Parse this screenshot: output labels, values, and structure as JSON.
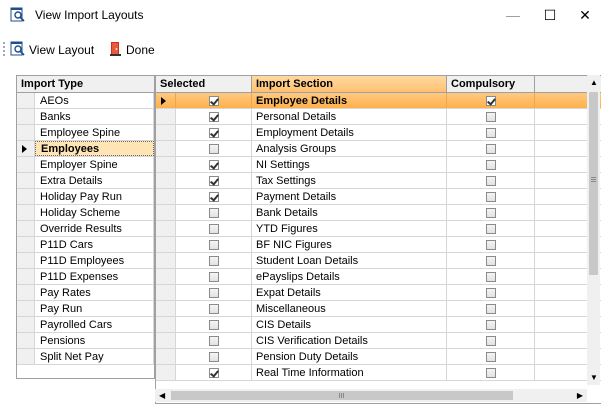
{
  "window": {
    "title": "View Import Layouts",
    "minimize_glyph": "—",
    "maximize_glyph": "☐",
    "close_glyph": "✕"
  },
  "toolbar": {
    "view_layout_label": "View Layout",
    "done_label": "Done"
  },
  "import_type": {
    "header": "Import Type",
    "items": [
      {
        "label": "AEOs"
      },
      {
        "label": "Banks"
      },
      {
        "label": "Employee Spine"
      },
      {
        "label": "Employees",
        "selected": true
      },
      {
        "label": "Employer Spine"
      },
      {
        "label": "Extra Details"
      },
      {
        "label": "Holiday Pay Run"
      },
      {
        "label": "Holiday Scheme"
      },
      {
        "label": "Override Results"
      },
      {
        "label": "P11D Cars"
      },
      {
        "label": "P11D Employees"
      },
      {
        "label": "P11D Expenses"
      },
      {
        "label": "Pay Rates"
      },
      {
        "label": "Pay Run"
      },
      {
        "label": "Payrolled Cars"
      },
      {
        "label": "Pensions"
      },
      {
        "label": "Split Net Pay"
      }
    ]
  },
  "import_section": {
    "headers": {
      "selected": "Selected",
      "section": "Import Section",
      "compulsory": "Compulsory"
    },
    "rows": [
      {
        "section": "Employee Details",
        "selected": true,
        "compulsory": true,
        "current": true
      },
      {
        "section": "Personal Details",
        "selected": true,
        "compulsory": false
      },
      {
        "section": "Employment Details",
        "selected": true,
        "compulsory": false
      },
      {
        "section": "Analysis Groups",
        "selected": false,
        "compulsory": false
      },
      {
        "section": "NI Settings",
        "selected": true,
        "compulsory": false
      },
      {
        "section": "Tax Settings",
        "selected": true,
        "compulsory": false
      },
      {
        "section": "Payment Details",
        "selected": true,
        "compulsory": false
      },
      {
        "section": "Bank Details",
        "selected": false,
        "compulsory": false
      },
      {
        "section": "YTD Figures",
        "selected": false,
        "compulsory": false
      },
      {
        "section": "BF NIC Figures",
        "selected": false,
        "compulsory": false
      },
      {
        "section": "Student Loan Details",
        "selected": false,
        "compulsory": false
      },
      {
        "section": "ePayslips Details",
        "selected": false,
        "compulsory": false
      },
      {
        "section": "Expat Details",
        "selected": false,
        "compulsory": false
      },
      {
        "section": "Miscellaneous",
        "selected": false,
        "compulsory": false
      },
      {
        "section": "CIS Details",
        "selected": false,
        "compulsory": false
      },
      {
        "section": "CIS Verification Details",
        "selected": false,
        "compulsory": false
      },
      {
        "section": "Pension Duty Details",
        "selected": false,
        "compulsory": false
      },
      {
        "section": "Real Time Information",
        "selected": true,
        "compulsory": false
      }
    ]
  },
  "colors": {
    "selection_orange": "#ffb14a",
    "grid_header": "#f0f0f0",
    "done_icon_red": "#d42b1e"
  },
  "icons": {
    "app": "view-layout-icon",
    "done": "door-exit-icon"
  }
}
